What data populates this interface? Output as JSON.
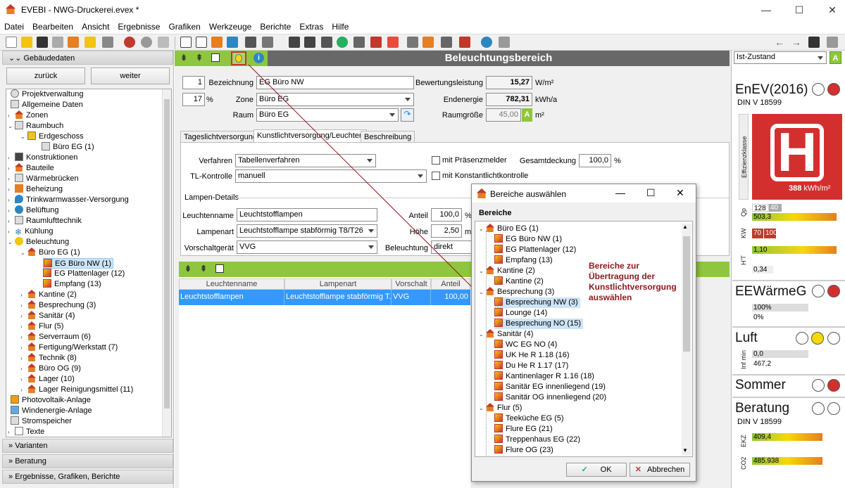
{
  "window": {
    "title": "EVEBI - NWG-Druckerei.evex *"
  },
  "menu": [
    "Datei",
    "Bearbeiten",
    "Ansicht",
    "Ergebnisse",
    "Grafiken",
    "Werkzeuge",
    "Berichte",
    "Extras",
    "Hilfe"
  ],
  "left": {
    "section": "Gebäudedaten",
    "back": "zurück",
    "forward": "weiter",
    "tree": [
      "Projektverwaltung",
      "Allgemeine Daten",
      "Zonen",
      "Raumbuch",
      "Erdgeschoss",
      "Büro EG (1)",
      "Konstruktionen",
      "Bauteile",
      "Wärmebrücken",
      "Beheizung",
      "Trinkwarmwasser-Versorgung",
      "Belüftung",
      "Raumlufttechnik",
      "Kühlung",
      "Beleuchtung",
      "Büro EG (1)",
      "EG Büro NW (1)",
      "EG Plattenlager (12)",
      "Empfang (13)",
      "Kantine (2)",
      "Besprechung (3)",
      "Sanitär (4)",
      "Flur (5)",
      "Serverraum (6)",
      "Fertigung/Werkstatt (7)",
      "Technik (8)",
      "Büro OG (9)",
      "Lager (10)",
      "Lager Reinigungsmittel (11)",
      "Photovoltaik-Anlage",
      "Windenergie-Anlage",
      "Stromspeicher",
      "Texte"
    ],
    "accordions": [
      "Varianten",
      "Beratung",
      "Ergebnisse, Grafiken, Berichte"
    ]
  },
  "main": {
    "header": "Beleuchtungsbereich",
    "nr": "1",
    "pct": "17",
    "pct_unit": "%",
    "bez_label": "Bezeichnung",
    "bez": "EG Büro NW",
    "zone_label": "Zone",
    "zone": "Büro EG",
    "raum_label": "Raum",
    "raum": "Büro EG",
    "bewert_label": "Bewertungsleistung",
    "bewert": "15,27",
    "bewert_unit": "W/m²",
    "endenergie_label": "Endenergie",
    "endenergie": "782,31",
    "endenergie_unit": "kWh/a",
    "raumgr_label": "Raumgröße",
    "raumgr": "45,00",
    "raumgr_unit": "m²",
    "raumgr_badge": "A",
    "tabs": [
      "Tageslichtversorgung",
      "Kunstlichtversorgung/Leuchten",
      "Beschreibung"
    ],
    "verfahren_label": "Verfahren",
    "verfahren": "Tabellenverfahren",
    "tl_label": "TL-Kontrolle",
    "tl": "manuell",
    "praes": "mit Präsenzmelder",
    "konst": "mit Konstantlichtkontrolle",
    "gesamt_label": "Gesamtdeckung",
    "gesamt": "100,0",
    "gesamt_unit": "%",
    "lampen_title": "Lampen-Details",
    "leuchtenname_label": "Leuchtenname",
    "leuchtenname": "Leuchtstofflampen",
    "lampenart_label": "Lampenart",
    "lampenart": "Leuchtstofflampe stabförmig T8/T26",
    "vorschalt_label": "Vorschaltgerät",
    "vorschalt": "VVG",
    "anteil_label": "Anteil",
    "anteil": "100,0",
    "anteil_unit": "%",
    "hoehe_label": "Höhe",
    "hoehe": "2,50",
    "hoehe_unit": "m",
    "beleuchtung_label": "Beleuchtung",
    "beleuchtung": "direkt",
    "grid_headers": [
      "Leuchtenname",
      "Lampenart",
      "Vorschalt",
      "Anteil"
    ],
    "grid_row": [
      "Leuchtstofflampen",
      "Leuchtstofflampe stabförmig T...",
      "VVG",
      "100,00"
    ]
  },
  "right": {
    "variant": "Ist-Zustand",
    "variant_badge": "A",
    "enev": "EnEV(2016)",
    "din": "DIN V 18599",
    "effklasse": "Effizienzklasse",
    "grade": "H",
    "grade_value": "388",
    "grade_unit": "kWh/m²",
    "qp_label": "Qp",
    "qp_ref": "128",
    "qp_ref2": "40",
    "qp": "503,3",
    "kw_label": "KW",
    "kw1": "70",
    "kw2": "100",
    "ht_label": "H'T",
    "ht": "1,10",
    "ht2": "0,34",
    "eew": "EEWärmeG",
    "eew1": "100%",
    "eew2": "0%",
    "luft": "Luft",
    "inf_label": "Inf min",
    "luft1": "0,0",
    "luft2": "467,2",
    "sommer": "Sommer",
    "beratung": "Beratung",
    "beratung_din": "DIN V 18599",
    "ekz_label": "EKZ",
    "ekz": "409,4",
    "co2_label": "CO2",
    "co2": "485.938",
    "colors": {
      "red": "#d32f2f",
      "yellow": "#f5d90a",
      "green": "#8fc640"
    }
  },
  "dialog": {
    "title": "Bereiche auswählen",
    "list_header": "Bereiche",
    "items": [
      {
        "t": "Büro EG (1)",
        "lvl": 0
      },
      {
        "t": "EG Büro NW (1)",
        "lvl": 1
      },
      {
        "t": "EG Plattenlager (12)",
        "lvl": 1
      },
      {
        "t": "Empfang (13)",
        "lvl": 1
      },
      {
        "t": "Kantine (2)",
        "lvl": 0
      },
      {
        "t": "Kantine (2)",
        "lvl": 1
      },
      {
        "t": "Besprechung (3)",
        "lvl": 0
      },
      {
        "t": "Besprechung NW (3)",
        "lvl": 1,
        "sel": true
      },
      {
        "t": "Lounge (14)",
        "lvl": 1
      },
      {
        "t": "Besprechung NO (15)",
        "lvl": 1,
        "sel": true
      },
      {
        "t": "Sanitär (4)",
        "lvl": 0
      },
      {
        "t": "WC EG NO (4)",
        "lvl": 1
      },
      {
        "t": "UK He  R 1.18 (16)",
        "lvl": 1
      },
      {
        "t": "Du He R 1.17 (17)",
        "lvl": 1
      },
      {
        "t": "Kantinenlager R 1.16 (18)",
        "lvl": 1
      },
      {
        "t": "Sanitär EG innenliegend (19)",
        "lvl": 1
      },
      {
        "t": "Sanitär OG innenliegend (20)",
        "lvl": 1
      },
      {
        "t": "Flur (5)",
        "lvl": 0
      },
      {
        "t": "Teeküche EG (5)",
        "lvl": 1
      },
      {
        "t": "Flure EG (21)",
        "lvl": 1
      },
      {
        "t": "Treppenhaus EG (22)",
        "lvl": 1
      },
      {
        "t": "Flure OG (23)",
        "lvl": 1
      }
    ],
    "annotation": [
      "Bereiche zur",
      "Übertragung der",
      "Kunstlichtversorgung",
      "auswählen"
    ],
    "ok": "OK",
    "cancel": "Abbrechen"
  }
}
